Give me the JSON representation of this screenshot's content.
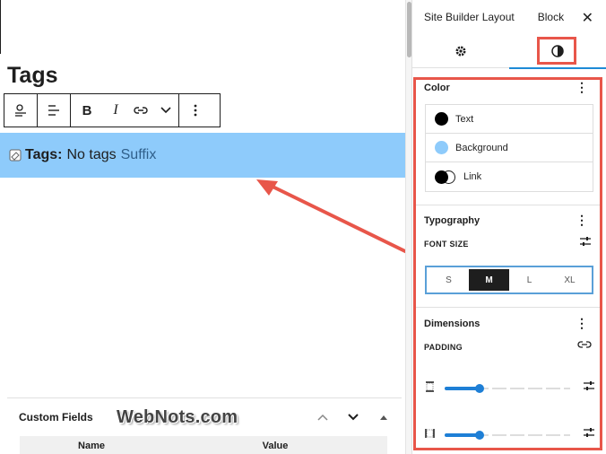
{
  "editor": {
    "block_title": "Tags",
    "toolbar": {
      "items": [
        "align-icon",
        "justify-icon",
        "bold",
        "italic",
        "link-icon",
        "more-chevron",
        "options-kebab"
      ],
      "bold_label": "B",
      "italic_label": "I"
    },
    "tags_block": {
      "prefix": "Tags:",
      "value": "No tags",
      "suffix": "Suffix"
    },
    "custom_fields": {
      "title": "Custom Fields",
      "columns": [
        "Name",
        "Value"
      ]
    },
    "watermark": "WebNots.com"
  },
  "sidebar": {
    "tabs": [
      {
        "label": "Site Builder Layout"
      },
      {
        "label": "Block"
      }
    ],
    "close_symbol": "✕",
    "icon_tabs": [
      "settings-gear-icon",
      "styles-half-circle-icon"
    ],
    "color": {
      "title": "Color",
      "items": [
        {
          "label": "Text",
          "swatch": "#000000"
        },
        {
          "label": "Background",
          "swatch": "#8ecbfb"
        },
        {
          "label": "Link",
          "swatch": "black-white"
        }
      ]
    },
    "typography": {
      "title": "Typography",
      "font_size_label": "FONT SIZE",
      "sizes": [
        "S",
        "M",
        "L",
        "XL"
      ],
      "selected_size": "M"
    },
    "dimensions": {
      "title": "Dimensions",
      "padding_label": "PADDING",
      "sliders": [
        {
          "side": "vertical",
          "value_fraction": 0.28
        },
        {
          "side": "horizontal",
          "value_fraction": 0.28
        }
      ]
    }
  },
  "colors": {
    "highlight_red": "#e8564a",
    "selected_block_bg": "#8ecbfb",
    "accent_blue": "#1e7fd6"
  }
}
